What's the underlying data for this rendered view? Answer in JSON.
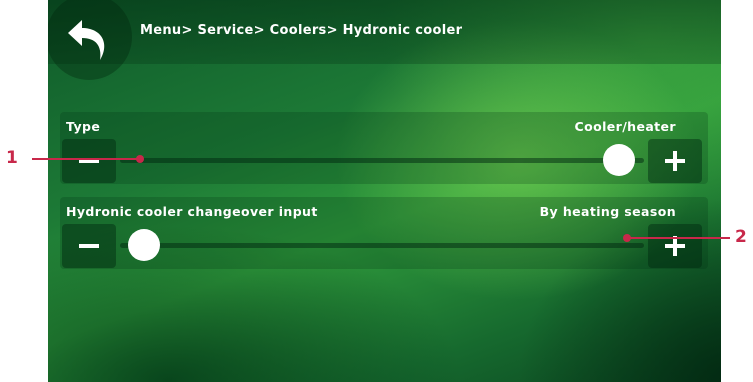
{
  "header": {
    "breadcrumb": "Menu> Service> Coolers> Hydronic cooler",
    "back_icon": "back-arrow-icon"
  },
  "settings": [
    {
      "label": "Type",
      "value": "Cooler/heater",
      "decrease_icon": "minus-icon",
      "increase_icon": "plus-icon",
      "slider_position": 1.0
    },
    {
      "label": "Hydronic cooler changeover input",
      "value": "By heating season",
      "decrease_icon": "minus-icon",
      "increase_icon": "plus-icon",
      "slider_position": 0.0
    }
  ],
  "callouts": [
    {
      "number": "1"
    },
    {
      "number": "2"
    }
  ],
  "colors": {
    "callout": "#c8284a",
    "screen_green": "#1d7a36",
    "text": "#ffffff"
  }
}
